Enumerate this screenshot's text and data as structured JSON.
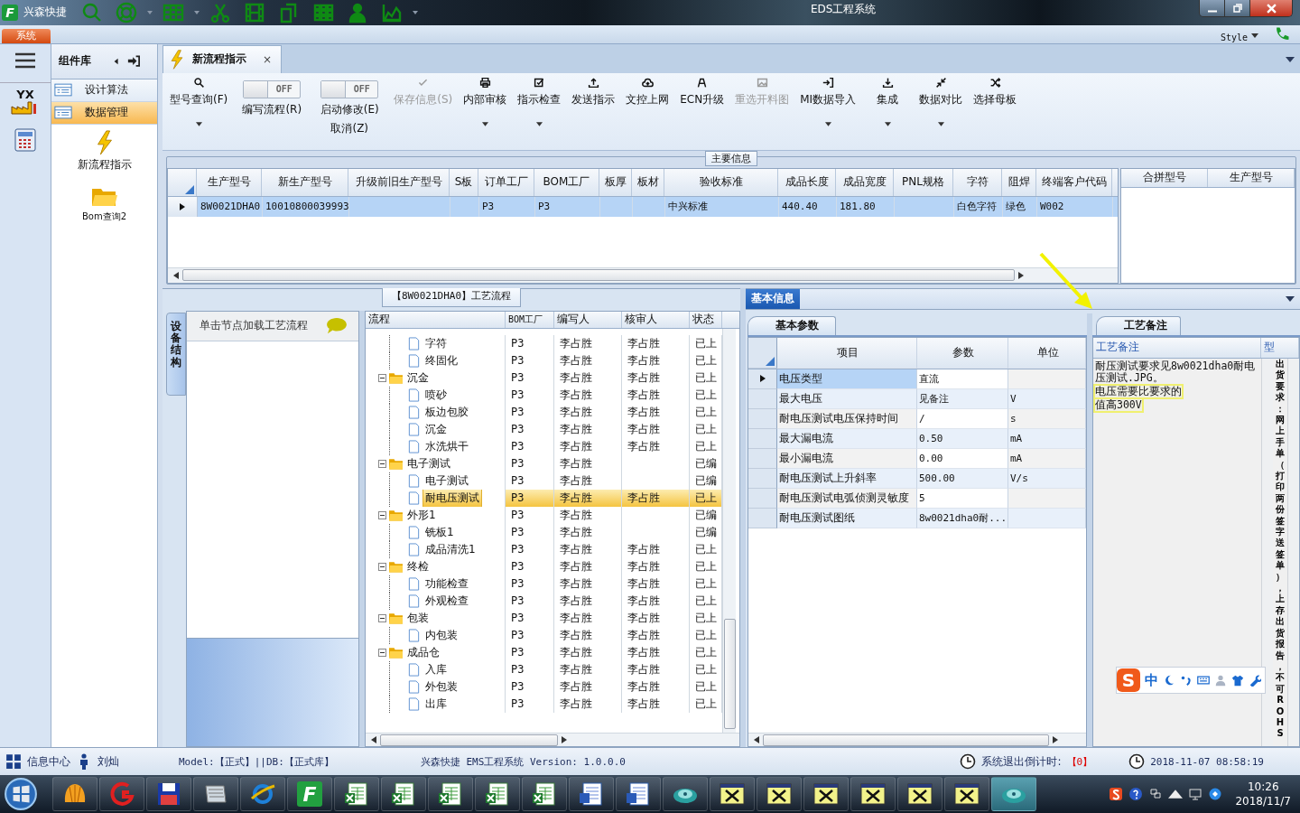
{
  "title_bar": {
    "logo_letter": "F",
    "app_name": "兴森快捷",
    "window_title": "EDS工程系统"
  },
  "ribbon": {
    "tab": "系统",
    "style_label": "Style"
  },
  "nav_logo": "YX",
  "component_library": {
    "title": "组件库",
    "items": [
      {
        "label": "设计算法",
        "selected": false
      },
      {
        "label": "数据管理",
        "selected": true
      }
    ],
    "shortcuts": [
      {
        "label": "新流程指示",
        "kind": "lightning"
      },
      {
        "label": "Bom查询2",
        "kind": "folder"
      }
    ]
  },
  "document_tab": {
    "label": "新流程指示",
    "close": "×"
  },
  "toolbar": [
    {
      "kind": "search",
      "label": "型号查询(F)",
      "disabled": false,
      "dropdown": true
    },
    {
      "kind": "toggle",
      "label": "编写流程(R)",
      "switch_text": "OFF",
      "on": false
    },
    {
      "kind": "toggle",
      "label": "启动修改(E)",
      "sublabel": "取消(Z)",
      "switch_text": "OFF",
      "on": false
    },
    {
      "kind": "check",
      "label": "保存信息(S)",
      "disabled": true,
      "dropdown": false
    },
    {
      "kind": "print",
      "label": "内部审核",
      "disabled": false,
      "dropdown": true
    },
    {
      "kind": "checkbox",
      "label": "指示检查",
      "disabled": false,
      "dropdown": true
    },
    {
      "kind": "upload",
      "label": "发送指示",
      "disabled": false,
      "dropdown": false
    },
    {
      "kind": "cloud",
      "label": "文控上网",
      "disabled": false,
      "dropdown": false
    },
    {
      "kind": "ecn",
      "label": "ECN升级",
      "disabled": false,
      "dropdown": false
    },
    {
      "kind": "image",
      "label": "重选开料图",
      "disabled": true,
      "dropdown": false
    },
    {
      "kind": "import",
      "label": "MI数据导入",
      "disabled": false,
      "dropdown": true
    },
    {
      "kind": "download",
      "label": "集成",
      "disabled": false,
      "dropdown": true
    },
    {
      "kind": "compress",
      "label": "数据对比",
      "disabled": false,
      "dropdown": true
    },
    {
      "kind": "shuffle",
      "label": "选择母板",
      "disabled": false,
      "dropdown": false
    }
  ],
  "main_info": {
    "title": "主要信息",
    "columns": [
      "生产型号",
      "新生产型号",
      "升级前旧生产型号",
      "S板",
      "订单工厂",
      "BOM工厂",
      "板厚",
      "板材",
      "验收标准",
      "成品长度",
      "成品宽度",
      "PNL规格",
      "字符",
      "阻焊",
      "终端客户代码"
    ],
    "rows": [
      {
        "selected": true,
        "cells": [
          "8W0021DHA0",
          "10010800039993",
          null,
          null,
          "P3",
          "P3",
          null,
          null,
          "中兴标准",
          "440.40",
          "181.80",
          null,
          "白色字符",
          "绿色",
          "W002"
        ]
      }
    ],
    "side_columns": [
      "合拼型号",
      "生产型号"
    ]
  },
  "process_flow": {
    "title": "【8W0021DHA0】工艺流程",
    "side_tab": "设备结构",
    "hint": "单击节点加载工艺流程",
    "columns": [
      "流程",
      "BOM工厂",
      "编写人",
      "核审人",
      "状态"
    ],
    "nodes": [
      {
        "children": [
          {
            "name": "字符",
            "bom": "P3",
            "writer": "李占胜",
            "reviewer": "李占胜",
            "status": "已上",
            "selected": false
          },
          {
            "name": "终固化",
            "bom": "P3",
            "writer": "李占胜",
            "reviewer": "李占胜",
            "status": "已上",
            "selected": false
          }
        ]
      },
      {
        "name": "沉金",
        "bom": "P3",
        "writer": "李占胜",
        "reviewer": "李占胜",
        "status": "已上",
        "selected": false,
        "expanded": true,
        "children": [
          {
            "name": "喷砂",
            "bom": "P3",
            "writer": "李占胜",
            "reviewer": "李占胜",
            "status": "已上",
            "selected": false
          },
          {
            "name": "板边包胶",
            "bom": "P3",
            "writer": "李占胜",
            "reviewer": "李占胜",
            "status": "已上",
            "selected": false
          },
          {
            "name": "沉金",
            "bom": "P3",
            "writer": "李占胜",
            "reviewer": "李占胜",
            "status": "已上",
            "selected": false
          },
          {
            "name": "水洗烘干",
            "bom": "P3",
            "writer": "李占胜",
            "reviewer": "李占胜",
            "status": "已上",
            "selected": false
          }
        ]
      },
      {
        "name": "电子测试",
        "bom": "P3",
        "writer": "李占胜",
        "status": "已编",
        "selected": false,
        "expanded": true,
        "children": [
          {
            "name": "电子测试",
            "bom": "P3",
            "writer": "李占胜",
            "status": "已编",
            "selected": false
          },
          {
            "name": "耐电压测试",
            "bom": "P3",
            "writer": "李占胜",
            "reviewer": "李占胜",
            "status": "已上",
            "selected": true
          }
        ]
      },
      {
        "name": "外形1",
        "bom": "P3",
        "writer": "李占胜",
        "status": "已编",
        "selected": false,
        "expanded": true,
        "children": [
          {
            "name": "铣板1",
            "bom": "P3",
            "writer": "李占胜",
            "status": "已编",
            "selected": false
          },
          {
            "name": "成品清洗1",
            "bom": "P3",
            "writer": "李占胜",
            "reviewer": "李占胜",
            "status": "已上",
            "selected": false
          }
        ]
      },
      {
        "name": "终检",
        "bom": "P3",
        "writer": "李占胜",
        "reviewer": "李占胜",
        "status": "已上",
        "selected": false,
        "expanded": true,
        "children": [
          {
            "name": "功能检查",
            "bom": "P3",
            "writer": "李占胜",
            "reviewer": "李占胜",
            "status": "已上",
            "selected": false
          },
          {
            "name": "外观检查",
            "bom": "P3",
            "writer": "李占胜",
            "reviewer": "李占胜",
            "status": "已上",
            "selected": false
          }
        ]
      },
      {
        "name": "包装",
        "bom": "P3",
        "writer": "李占胜",
        "reviewer": "李占胜",
        "status": "已上",
        "selected": false,
        "expanded": true,
        "children": [
          {
            "name": "内包装",
            "bom": "P3",
            "writer": "李占胜",
            "reviewer": "李占胜",
            "status": "已上",
            "selected": false
          }
        ]
      },
      {
        "name": "成品仓",
        "bom": "P3",
        "writer": "李占胜",
        "reviewer": "李占胜",
        "status": "已上",
        "selected": false,
        "expanded": true,
        "children": [
          {
            "name": "入库",
            "bom": "P3",
            "writer": "李占胜",
            "reviewer": "李占胜",
            "status": "已上",
            "selected": false
          },
          {
            "name": "外包装",
            "bom": "P3",
            "writer": "李占胜",
            "reviewer": "李占胜",
            "status": "已上",
            "selected": false
          },
          {
            "name": "出库",
            "bom": "P3",
            "writer": "李占胜",
            "reviewer": "李占胜",
            "status": "已上",
            "selected": false
          }
        ]
      }
    ]
  },
  "basic_info": {
    "title": "基本信息",
    "tab": "基本参数",
    "columns": [
      "项目",
      "参数",
      "单位"
    ],
    "rows": [
      {
        "item": "电压类型",
        "value": "直流",
        "selected": true
      },
      {
        "item": "最大电压",
        "value": "见备注",
        "unit": "V",
        "selected": false
      },
      {
        "item": "耐电压测试电压保持时间",
        "value": "/",
        "unit": "s",
        "selected": false
      },
      {
        "item": "最大漏电流",
        "value": "0.50",
        "unit": "mA",
        "selected": false
      },
      {
        "item": "最小漏电流",
        "value": "0.00",
        "unit": "mA",
        "selected": false
      },
      {
        "item": "耐电压测试上升斜率",
        "value": "500.00",
        "unit": "V/s",
        "selected": false
      },
      {
        "item": "耐电压测试电弧侦测灵敏度",
        "value": "5",
        "selected": false
      },
      {
        "item": "耐电压测试图纸",
        "value": "8w0021dha0耐...",
        "selected": false
      }
    ]
  },
  "remarks": {
    "tab": "工艺备注",
    "columns": [
      "工艺备注",
      "型"
    ],
    "note": [
      {
        "text": "耐压测试要求见8w0021dha0耐电压测试.JPG。",
        "highlighted": false
      },
      {
        "text": "电压需要比要求的",
        "highlighted": true
      },
      {
        "text": "值高300V",
        "highlighted": true
      }
    ],
    "side_text": "出货要求：网上手单（打印两份签字送签单），上存出货报告，不可ROHS"
  },
  "ime_toolbar": {
    "logo": "S",
    "mode": "中"
  },
  "status_bar": {
    "info_center": "信息中心",
    "user": "刘灿",
    "model_db": "Model:【正式】||DB:【正式库】",
    "version": "兴森快捷 EMS工程系统 Version: 1.0.0.0",
    "countdown_label": "系统退出倒计时:",
    "countdown": "【0】",
    "datetime": "2018-11-07 08:58:19"
  },
  "taskbar": {
    "app_letter": "F",
    "time": "10:26",
    "date": "2018/11/7"
  }
}
